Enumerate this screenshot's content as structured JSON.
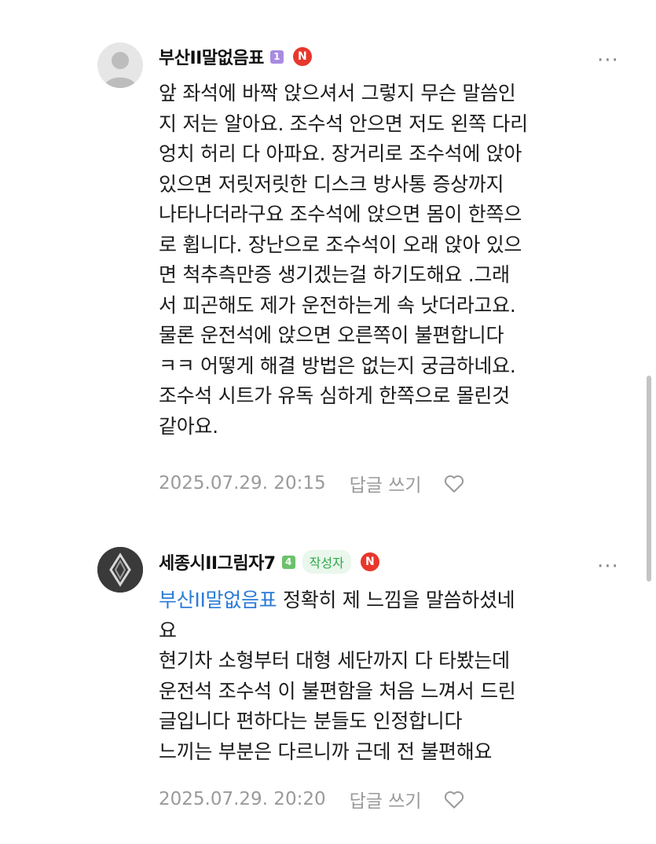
{
  "comments": [
    {
      "nickname": "부산II말없음표",
      "level": "1",
      "n_badge": "N",
      "more": "···",
      "text": "앞 좌석에 바짝 앉으셔서 그렇지 무슨 말씀인\n지 저는 알아요. 조수석 안으면 저도 왼쪽 다리\n엉치 허리 다 아파요. 장거리로 조수석에 앉아\n있으면 저릿저릿한 디스크 방사통 증상까지\n나타나더라구요 조수석에 앉으면 몸이 한쪽으\n로 휩니다. 장난으로 조수석이 오래 앉아 있으\n면 척추측만증 생기겠는걸 하기도해요 .그래\n서 피곤해도 제가 운전하는게 속 낫더라고요.\n물론 운전석에 앉으면 오른쪽이 불편합니다\nㅋㅋ 어떻게 해결 방법은 없는지 궁금하네요.\n조수석 시트가 유독 심하게 한쪽으로 몰린것\n같아요.",
      "timestamp": "2025.07.29. 20:15",
      "reply_label": "답글 쓰기"
    },
    {
      "nickname": "세종시II그림자7",
      "level": "4",
      "author_badge": "작성자",
      "n_badge": "N",
      "more": "···",
      "mention": "부산II말없음표",
      "text_first": " 정확히 제 느낌을 말씀하셨네\n요\n현기차 소형부터 대형 세단까지 다 타봤는데\n운전석 조수석 이 불편함을 처음 느껴서 드린\n글입니다 편하다는 분들도 인정합니다\n느끼는 부분은 다르니까 근데 전 불편해요",
      "timestamp": "2025.07.29. 20:20",
      "reply_label": "답글 쓰기"
    }
  ],
  "colors": {
    "mention": "#2b7bd6",
    "n_badge": "#e8372c",
    "author_badge_text": "#2fa84a",
    "level_1": "#a98be2",
    "level_4": "#6cc26a"
  },
  "icons": [
    "default-avatar-icon",
    "emblem-avatar-icon",
    "more-icon",
    "heart-icon"
  ]
}
